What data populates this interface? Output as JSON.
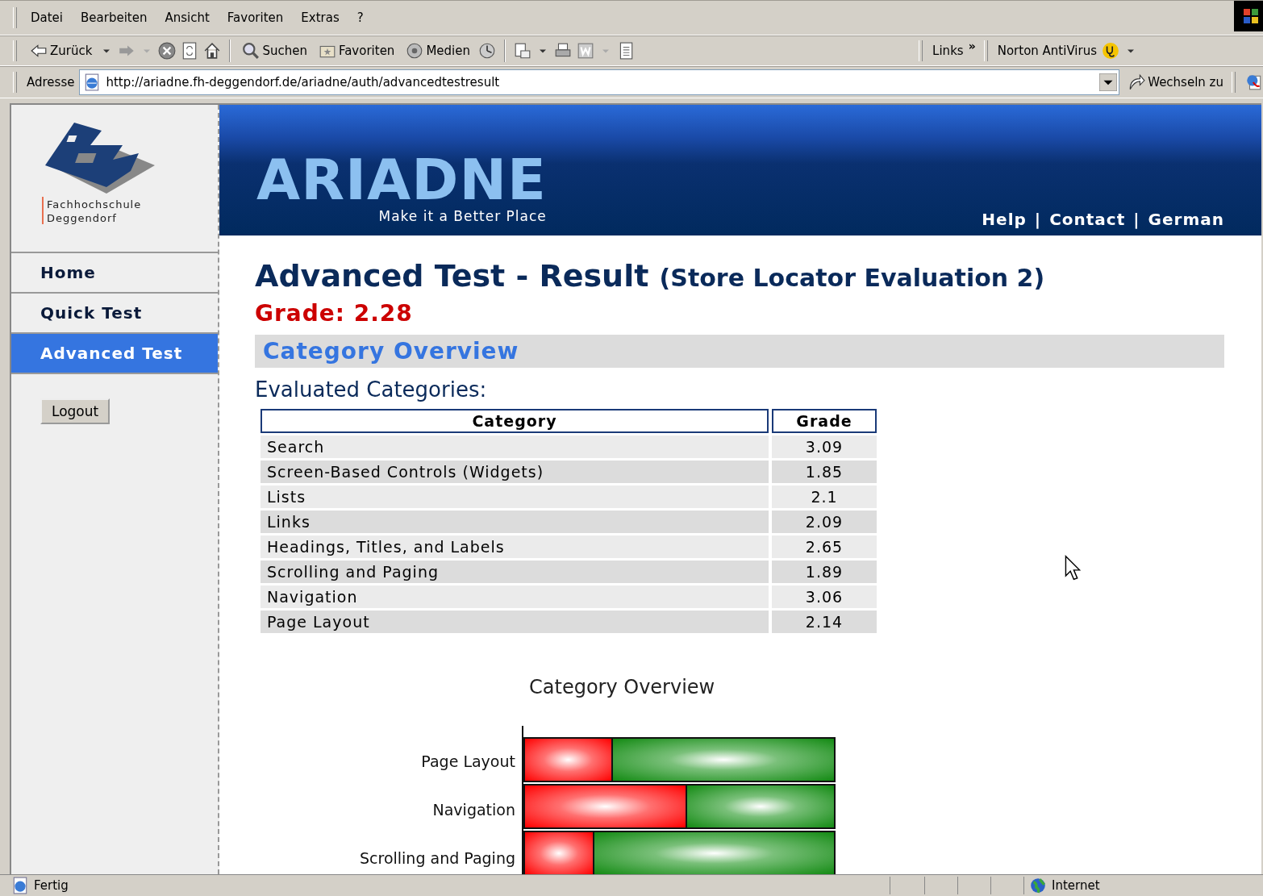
{
  "menu_bar": [
    "Datei",
    "Bearbeiten",
    "Ansicht",
    "Favoriten",
    "Extras",
    "?"
  ],
  "toolbar": {
    "back": "Zurück",
    "search": "Suchen",
    "favorites": "Favoriten",
    "media": "Medien",
    "links": "Links",
    "links_more": "»",
    "norton": "Norton AntiVirus"
  },
  "address_bar": {
    "label": "Adresse",
    "url": "http://ariadne.fh-deggendorf.de/ariadne/auth/advancedtestresult",
    "go": "Wechseln zu"
  },
  "logo": {
    "line1": "Fachhochschule",
    "line2": "Deggendorf"
  },
  "banner": {
    "title": "ARIADNE",
    "tagline": "Make it a Better Place",
    "links": [
      "Help",
      "Contact",
      "German"
    ],
    "separator": "|"
  },
  "sidebar": {
    "items": [
      {
        "label": "Home",
        "selected": false
      },
      {
        "label": "Quick Test",
        "selected": false
      },
      {
        "label": "Advanced Test",
        "selected": true
      }
    ],
    "logout": "Logout"
  },
  "page": {
    "title": "Advanced Test - Result",
    "subtitle": "(Store Locator Evaluation 2)",
    "grade": "Grade: 2.28",
    "section": "Category Overview",
    "table_title": "Evaluated Categories:"
  },
  "table": {
    "columns": [
      "Category",
      "Grade"
    ],
    "rows": [
      {
        "category": "Search",
        "grade": "3.09"
      },
      {
        "category": "Screen-Based Controls (Widgets)",
        "grade": "1.85"
      },
      {
        "category": "Lists",
        "grade": "2.1"
      },
      {
        "category": "Links",
        "grade": "2.09"
      },
      {
        "category": "Headings, Titles, and Labels",
        "grade": "2.65"
      },
      {
        "category": "Scrolling and Paging",
        "grade": "1.89"
      },
      {
        "category": "Navigation",
        "grade": "3.06"
      },
      {
        "category": "Page Layout",
        "grade": "2.14"
      }
    ]
  },
  "chart": {
    "title": "Category Overview",
    "bars": [
      {
        "label": "Page Layout",
        "level": 0.28
      },
      {
        "label": "Navigation",
        "level": 0.52
      },
      {
        "label": "Scrolling and Paging",
        "level": 0.22
      }
    ]
  },
  "status_bar": {
    "text": "Fertig",
    "zone": "Internet"
  }
}
